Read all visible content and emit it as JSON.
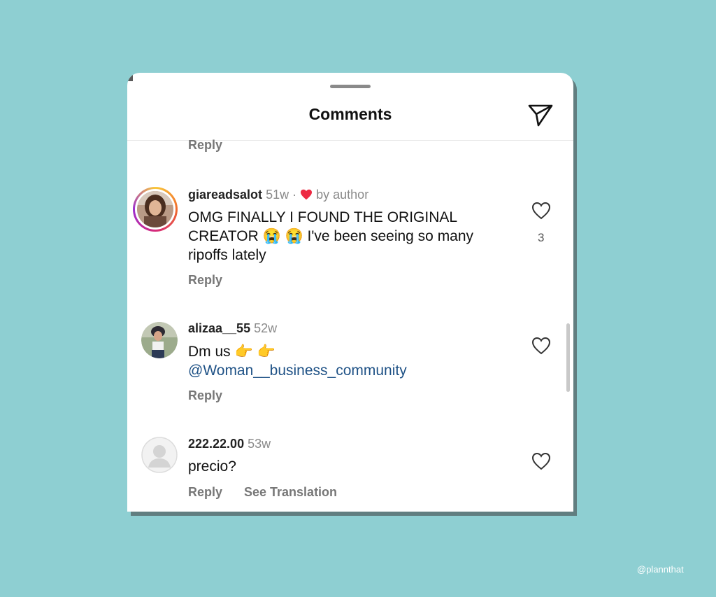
{
  "sheet": {
    "title": "Comments"
  },
  "top_reply_label": "Reply",
  "comments": [
    {
      "username": "giareadsalot",
      "time": "51w",
      "separator": "·",
      "author_badge": "by author",
      "text_line1": "OMG FINALLY I FOUND THE ORIGINAL",
      "text_line2_prefix": "CREATOR",
      "emoji": "😭 😭",
      "text_line2_suffix": " I've been seeing so many",
      "text_line3": "ripoffs lately",
      "likes": "3",
      "reply_label": "Reply"
    },
    {
      "username": "alizaa__55",
      "time": "52w",
      "text_line1_prefix": "Dm us ",
      "emoji": "👉 👉",
      "mention": "@Woman__business_community",
      "reply_label": "Reply"
    },
    {
      "username": "222.22.00",
      "time": "53w",
      "text": "precio?",
      "reply_label": "Reply",
      "translation_label": "See Translation"
    }
  ],
  "watermark": "@plannthat",
  "colors": {
    "background": "#8ecfd2",
    "heart_red": "#ed2942",
    "mention_blue": "#1f5286"
  },
  "icons": [
    "send-icon",
    "heart-outline-icon",
    "heart-filled-icon"
  ]
}
